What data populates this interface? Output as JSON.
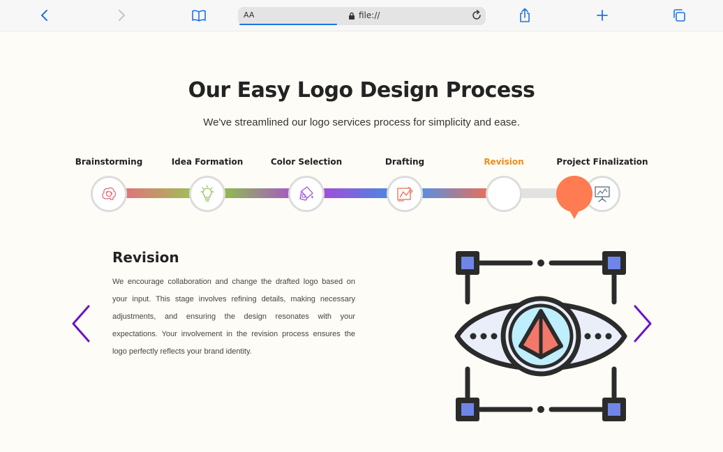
{
  "browser": {
    "text_size_label": "AA",
    "url": "file://"
  },
  "section": {
    "title": "Our Easy Logo Design Process",
    "subtitle": "We've streamlined our logo services process for simplicity and ease."
  },
  "steps": [
    {
      "label": "Brainstorming",
      "icon": "brain-icon"
    },
    {
      "label": "Idea Formation",
      "icon": "lightbulb-icon"
    },
    {
      "label": "Color Selection",
      "icon": "paint-bucket-icon"
    },
    {
      "label": "Drafting",
      "icon": "drafting-icon"
    },
    {
      "label": "Revision",
      "icon": "eye-icon",
      "active": true
    },
    {
      "label": "Project Finalization",
      "icon": "presentation-icon"
    }
  ],
  "active_step": 4,
  "detail": {
    "title": "Revision",
    "body": "We encourage collaboration and change the drafted logo based on your input. This stage involves refining details, making necessary adjustments, and ensuring the design resonates with your expectations. Your involvement in the revision process ensures the logo perfectly reflects your brand identity."
  },
  "colors": {
    "accent_orange": "#f28c1b",
    "marker": "#ff7b52",
    "arrow_purple": "#6a12c9",
    "browser_blue": "#1a73e8"
  }
}
